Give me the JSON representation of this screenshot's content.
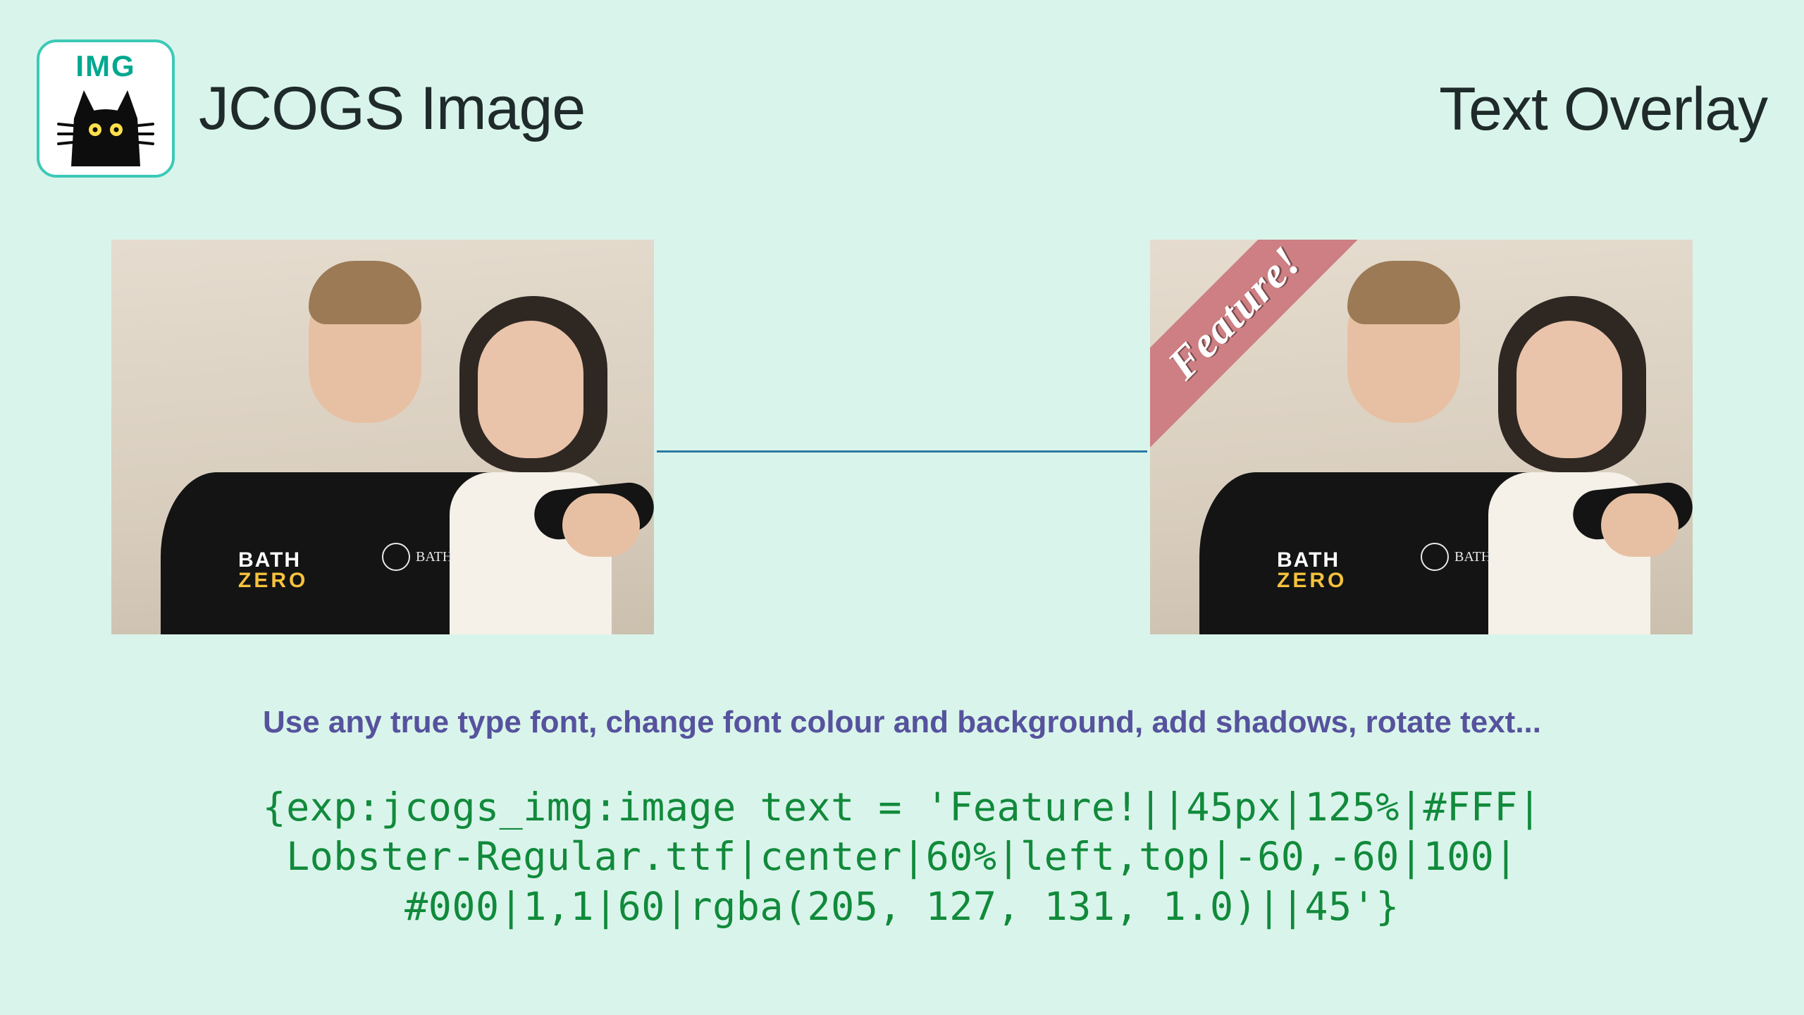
{
  "header": {
    "logo_text": "IMG",
    "product_name": "JCOGS Image",
    "page_title": "Text Overlay"
  },
  "images": {
    "shirt_line1": "BATH",
    "shirt_line2": "ZERO",
    "shirt_badge": "BATH",
    "ribbon_text": "Feature!",
    "ribbon_bg": "rgba(205, 127, 131, 1.0)"
  },
  "caption": "Use any true type font, change font colour and background, add shadows, rotate text...",
  "code": "{exp:jcogs_img:image text = 'Feature!||45px|125%|#FFF|\nLobster-Regular.ttf|center|60%|left,top|-60,-60|100|\n#000|1,1|60|rgba(205, 127, 131, 1.0)||45'}"
}
